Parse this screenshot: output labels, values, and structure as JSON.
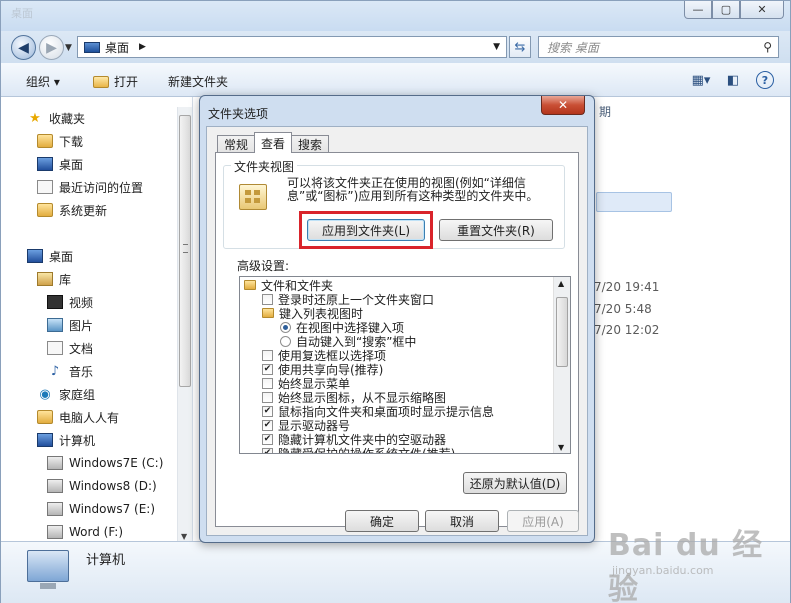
{
  "explorer": {
    "title": "桌面",
    "window_buttons": [
      "—",
      "▢",
      "✕"
    ],
    "address": {
      "crumb": "桌面"
    },
    "search": {
      "placeholder": "搜索 桌面"
    },
    "toolbar": {
      "organize": "组织 ▾",
      "open": "打开",
      "new_folder": "新建文件夹"
    },
    "nav": {
      "favorites": "收藏夹",
      "downloads": "下载",
      "desktop_fav": "桌面",
      "recent": "最近访问的位置",
      "system_update": "系统更新",
      "desktop": "桌面",
      "libraries": "库",
      "videos": "视频",
      "pictures": "图片",
      "documents": "文档",
      "music": "音乐",
      "homegroup": "家庭组",
      "user_folder": "电脑人人有",
      "computer": "计算机",
      "drives": [
        "Windows7E (C:)",
        "Windows8 (D:)",
        "Windows7 (E:)",
        "Word (F:)"
      ]
    },
    "filearea": {
      "column_header": "期",
      "times": [
        "7/20 19:41",
        "7/20 5:48",
        "7/20 12:02"
      ]
    },
    "details": {
      "label": "计算机"
    }
  },
  "dialog": {
    "title": "文件夹选项",
    "close": "✕",
    "tabs": [
      "常规",
      "查看",
      "搜索"
    ],
    "folder_views": {
      "title": "文件夹视图",
      "description": "可以将该文件夹正在使用的视图(例如“详细信息”或“图标”)应用到所有这种类型的文件夹中。",
      "apply_button": "应用到文件夹(L)",
      "reset_button": "重置文件夹(R)"
    },
    "advanced_label": "高级设置:",
    "tree": [
      {
        "type": "folder",
        "label": "文件和文件夹"
      },
      {
        "type": "check",
        "checked": false,
        "label": "登录时还原上一个文件夹窗口"
      },
      {
        "type": "folder",
        "label": "键入列表视图时"
      },
      {
        "type": "radio",
        "checked": true,
        "label": "在视图中选择键入项"
      },
      {
        "type": "radio",
        "checked": false,
        "label": "自动键入到“搜索”框中"
      },
      {
        "type": "check",
        "checked": false,
        "label": "使用复选框以选择项"
      },
      {
        "type": "check",
        "checked": true,
        "label": "使用共享向导(推荐)"
      },
      {
        "type": "check",
        "checked": false,
        "label": "始终显示菜单"
      },
      {
        "type": "check",
        "checked": false,
        "label": "始终显示图标，从不显示缩略图"
      },
      {
        "type": "check",
        "checked": true,
        "label": "鼠标指向文件夹和桌面项时显示提示信息"
      },
      {
        "type": "check",
        "checked": true,
        "label": "显示驱动器号"
      },
      {
        "type": "check",
        "checked": true,
        "label": "隐藏计算机文件夹中的空驱动器"
      },
      {
        "type": "check",
        "checked": true,
        "label": "隐藏受保护的操作系统文件(推荐)"
      }
    ],
    "restore_defaults": "还原为默认值(D)",
    "ok": "确定",
    "cancel": "取消",
    "apply": "应用(A)"
  },
  "watermark": {
    "brand": "Bai  du 经验",
    "url": "jingyan.baidu.com"
  },
  "colors": {
    "highlight_box": "#d9242b",
    "titlebar": "#cfdef0"
  }
}
